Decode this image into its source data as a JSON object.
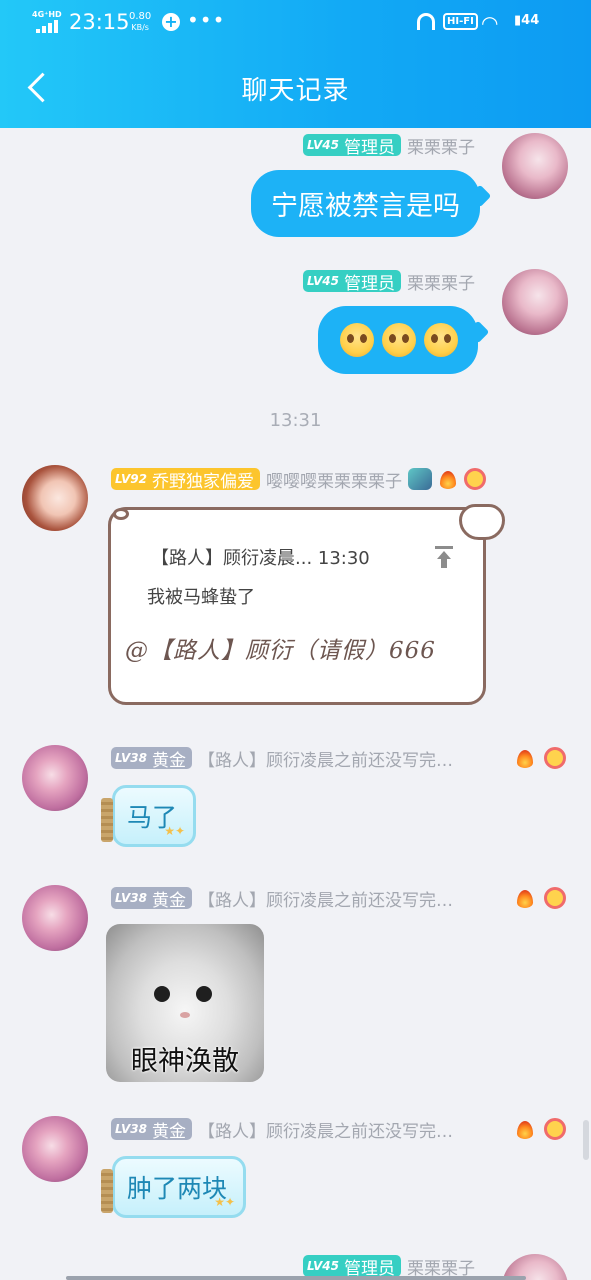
{
  "status_bar": {
    "network": "4G⁺HD",
    "time": "23:15",
    "speed_value": "0.80",
    "speed_unit": "KB/s",
    "dots": "•••",
    "hifi": "HI-FI",
    "battery": "44"
  },
  "header": {
    "title": "聊天记录"
  },
  "colors": {
    "accent": "#1db2f6",
    "level_admin": "#36cfc3",
    "level_vip": "#fcc52d",
    "level_gold": "#a7afc3"
  },
  "messages": [
    {
      "level": "LV45",
      "title": "管理员",
      "nickname": "栗栗栗子",
      "text": "宁愿被禁言是吗"
    },
    {
      "level": "LV45",
      "title": "管理员",
      "nickname": "栗栗栗子",
      "emoji": [
        "pleading-face",
        "pleading-face",
        "pleading-face"
      ]
    }
  ],
  "timestamp": "13:31",
  "reply_card": {
    "level": "LV92",
    "title": "乔野独家偏爱",
    "nickname": "嘤嘤嘤栗栗栗栗子",
    "quote_author_time": "【路人】顾衍凌晨... 13:30",
    "quote_text": "我被马蜂蛰了",
    "reply": "@【路人】顾衍（请假）666"
  },
  "incoming": [
    {
      "level": "LV38",
      "title": "黄金",
      "nickname": "【路人】顾衍凌晨之前还没写完…",
      "text": "马了"
    },
    {
      "level": "LV38",
      "title": "黄金",
      "nickname": "【路人】顾衍凌晨之前还没写完…",
      "sticker_caption": "眼神涣散"
    },
    {
      "level": "LV38",
      "title": "黄金",
      "nickname": "【路人】顾衍凌晨之前还没写完…",
      "text": "肿了两块"
    }
  ],
  "last": {
    "level": "LV45",
    "title": "管理员",
    "nickname": "栗栗栗子"
  }
}
